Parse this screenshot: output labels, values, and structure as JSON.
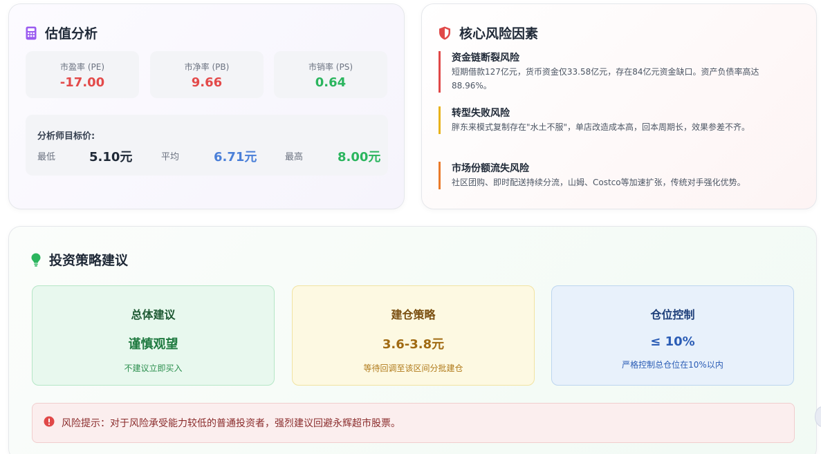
{
  "valuation": {
    "title": "估值分析",
    "metrics": [
      {
        "label": "市盈率 (PE)",
        "value": "-17.00",
        "color": "#e34a4a"
      },
      {
        "label": "市净率 (PB)",
        "value": "9.66",
        "color": "#e34a4a"
      },
      {
        "label": "市销率 (PS)",
        "value": "0.64",
        "color": "#2bb55e"
      }
    ],
    "target": {
      "header": "分析师目标价:",
      "low_label": "最低",
      "low_value": "5.10元",
      "avg_label": "平均",
      "avg_value": "6.71元",
      "high_label": "最高",
      "high_value": "8.00元"
    }
  },
  "risk": {
    "title": "核心风险因素",
    "items": [
      {
        "title": "资金链断裂风险",
        "desc": "短期借款127亿元，货币资金仅33.58亿元，存在84亿元资金缺口。资产负债率高达88.96%。",
        "color": "#e04848"
      },
      {
        "title": "转型失败风险",
        "desc": "胖东来模式复制存在\"水土不服\"，单店改造成本高，回本周期长，效果参差不齐。",
        "color": "#e8b21a"
      },
      {
        "title": "市场份额流失风险",
        "desc": "社区团购、即时配送持续分流，山姆、Costco等加速扩张，传统对手强化优势。",
        "color": "#ea7a2a"
      }
    ]
  },
  "strategy": {
    "title": "投资策略建议",
    "boxes": [
      {
        "heading": "总体建议",
        "value": "谨慎观望",
        "desc": "不建议立即买入"
      },
      {
        "heading": "建仓策略",
        "value": "3.6-3.8元",
        "desc": "等待回调至该区间分批建仓"
      },
      {
        "heading": "仓位控制",
        "value": "≤ 10%",
        "desc": "严格控制总仓位在10%以内"
      }
    ],
    "warning": "风险提示：对于风险承受能力较低的普通投资者，强烈建议回避永辉超市股票。"
  }
}
